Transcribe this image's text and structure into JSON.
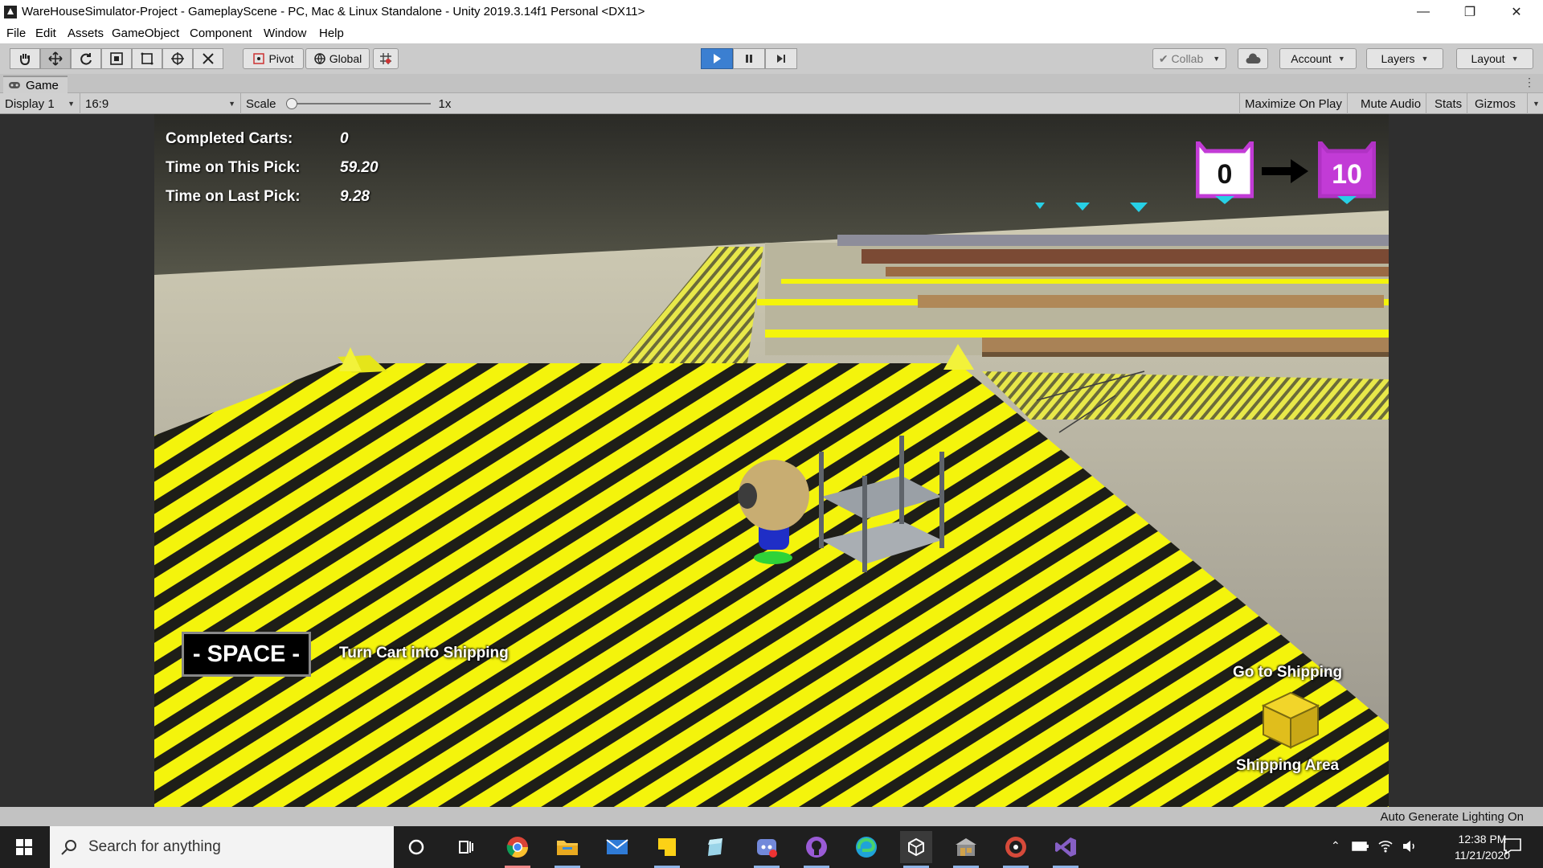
{
  "window": {
    "title": "WareHouseSimulator-Project - GameplayScene - PC, Mac & Linux Standalone - Unity 2019.3.14f1 Personal <DX11>",
    "minimize": "—",
    "maximize": "❐",
    "close": "✕"
  },
  "menu": [
    "File",
    "Edit",
    "Assets",
    "GameObject",
    "Component",
    "Window",
    "Help"
  ],
  "toolbar": {
    "pivot_label": "Pivot",
    "global_label": "Global",
    "collab_label": "Collab",
    "account_label": "Account",
    "layers_label": "Layers",
    "layout_label": "Layout"
  },
  "game_panel": {
    "tab_label": "Game",
    "display": "Display 1",
    "aspect": "16:9",
    "scale_label": "Scale",
    "scale_value": "1x",
    "scale_level": 0,
    "maximize_on_play": "Maximize On Play",
    "mute_audio": "Mute Audio",
    "stats": "Stats",
    "gizmos": "Gizmos"
  },
  "hud": {
    "completed_carts_label": "Completed Carts:",
    "completed_carts_value": "0",
    "time_this_pick_label": "Time on This Pick:",
    "time_this_pick_value": "59.20",
    "time_last_pick_label": "Time on Last Pick:",
    "time_last_pick_value": "9.28",
    "bin_from": "0",
    "bin_to": "10",
    "space_key": "- SPACE -",
    "space_hint": "Turn Cart into Shipping",
    "go_to_shipping": "Go to Shipping",
    "shipping_area": "Shipping Area"
  },
  "status": {
    "lighting": "Auto Generate Lighting On"
  },
  "taskbar": {
    "search_placeholder": "Search for anything",
    "time": "12:38 PM",
    "date": "11/21/2020",
    "apps": [
      "cortana-icon",
      "task-view-icon",
      "chrome-icon",
      "file-explorer-icon",
      "mail-icon",
      "sticky-notes-icon",
      "app-icon",
      "discord-icon",
      "github-icon",
      "edge-icon",
      "unity-icon",
      "warehouse-app-icon",
      "media-icon",
      "visual-studio-icon"
    ]
  },
  "colors": {
    "play_active": "#3b7fd1",
    "hazard_yellow": "#f2f20a",
    "bin_purple": "#c23bd6"
  }
}
